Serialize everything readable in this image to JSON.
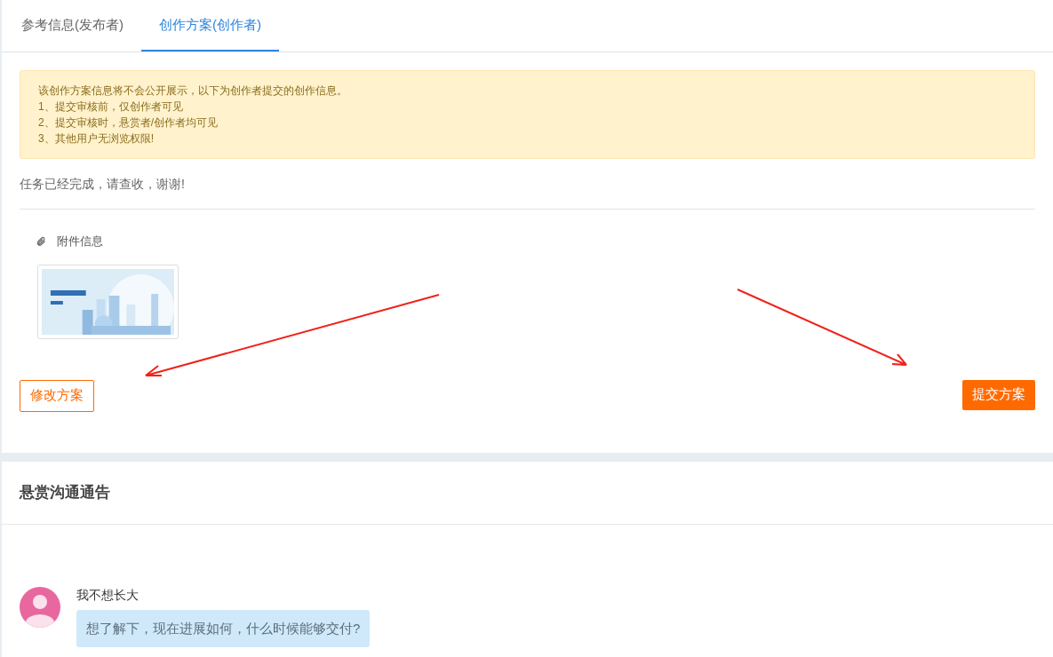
{
  "tabs": [
    {
      "label": "参考信息(发布者)",
      "selected": false
    },
    {
      "label": "创作方案(创作者)",
      "selected": true
    }
  ],
  "notice": {
    "lines": [
      "该创作方案信息将不会公开展示，以下为创作者提交的创作信息。",
      "1、提交审核前，仅创作者可见",
      "2、提交审核时，悬赏者/创作者均可见",
      "3、其他用户无浏览权限!"
    ]
  },
  "message": "任务已经完成，请查收，谢谢!",
  "attachments": {
    "title": "附件信息"
  },
  "buttons": [
    {
      "label": "修改方案",
      "kind": "outline"
    },
    {
      "label": "提交方案",
      "kind": "primary"
    }
  ],
  "comments_section": {
    "title": "悬赏沟通通告",
    "comments": [
      {
        "author": "我不想长大",
        "text": "想了解下，现在进展如何，什么时候能够交付?"
      }
    ]
  }
}
